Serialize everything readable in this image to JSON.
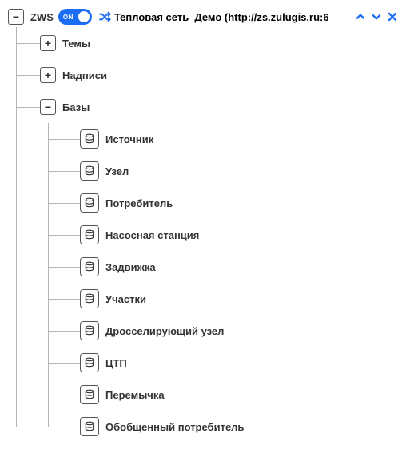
{
  "root": {
    "label": "ZWS",
    "toggle_text": "ON",
    "title": "Тепловая сеть_Демо (http://zs.zulugis.ru:6"
  },
  "children": [
    {
      "label": "Темы",
      "expander": "+"
    },
    {
      "label": "Надписи",
      "expander": "+"
    },
    {
      "label": "Базы",
      "expander": "-"
    }
  ],
  "bases": [
    {
      "label": "Источник"
    },
    {
      "label": "Узел"
    },
    {
      "label": "Потребитель"
    },
    {
      "label": "Насосная станция"
    },
    {
      "label": "Задвижка"
    },
    {
      "label": "Участки"
    },
    {
      "label": "Дросселирующий узел"
    },
    {
      "label": "ЦТП"
    },
    {
      "label": "Перемычка"
    },
    {
      "label": "Обобщенный потребитель"
    }
  ]
}
